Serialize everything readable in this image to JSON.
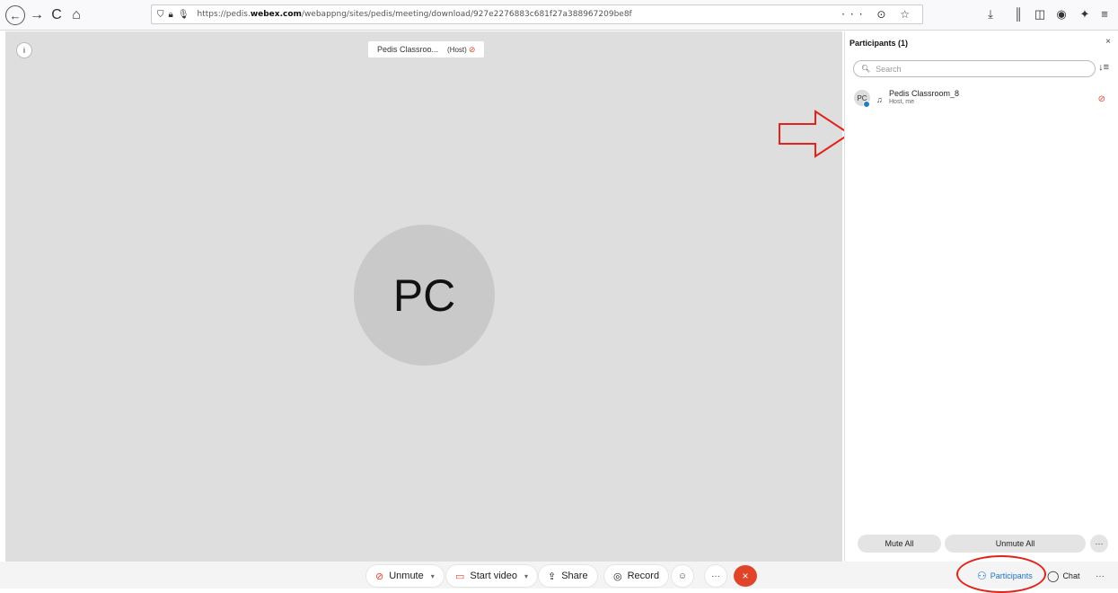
{
  "browser": {
    "back_icon": "←",
    "forward_icon": "→",
    "reload_icon": "C",
    "home_icon": "⌂",
    "url_prefix": "https://pedis.",
    "url_domain": "webex.com",
    "url_path": "/webappng/sites/pedis/meeting/download/927e2276883c681f27a388967209be8f",
    "page_actions": "··· ⊙ ☆"
  },
  "meeting": {
    "title": "Pedis Classroo...",
    "host_tag": "(Host)",
    "avatar_initials": "PC"
  },
  "controls": {
    "unmute": "Unmute",
    "start_video": "Start video",
    "share": "Share",
    "record": "Record",
    "more": "···",
    "leave": "×",
    "participants": "Participants",
    "chat": "Chat",
    "right_more": "···"
  },
  "participants_panel": {
    "title": "Participants (1)",
    "close": "×",
    "search_placeholder": "Search",
    "participants": [
      {
        "initials": "PC",
        "name": "Pedis Classroom_8",
        "role": "Host, me"
      }
    ],
    "mute_all": "Mute All",
    "unmute_all": "Unmute All",
    "more": "···"
  },
  "colors": {
    "accent_red": "#e0452a",
    "link_blue": "#1a73c9",
    "stage_bg": "#dedede"
  }
}
